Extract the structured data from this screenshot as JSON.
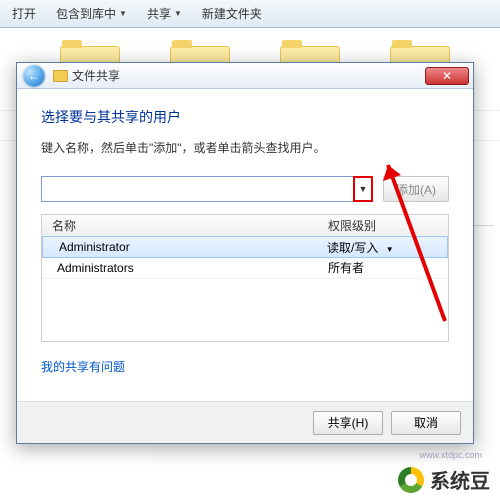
{
  "explorer": {
    "toolbar": {
      "open": "打开",
      "include": "包含到库中",
      "share": "共享",
      "new_folder": "新建文件夹"
    }
  },
  "dialog": {
    "title": "文件共享",
    "heading": "选择要与其共享的用户",
    "subtext": "键入名称，然后单击\"添加\"，或者单击箭头查找用户。",
    "add_button": "添加(A)",
    "columns": {
      "name": "名称",
      "permission": "权限级别"
    },
    "users": [
      {
        "name": "Administrator",
        "permission": "读取/写入"
      },
      {
        "name": "Administrators",
        "permission": "所有者"
      }
    ],
    "help_link": "我的共享有问题",
    "footer": {
      "share": "共享(H)",
      "cancel": "取消"
    }
  },
  "brand": {
    "text": "系统豆"
  },
  "watermark": "www.xtdpc.com"
}
